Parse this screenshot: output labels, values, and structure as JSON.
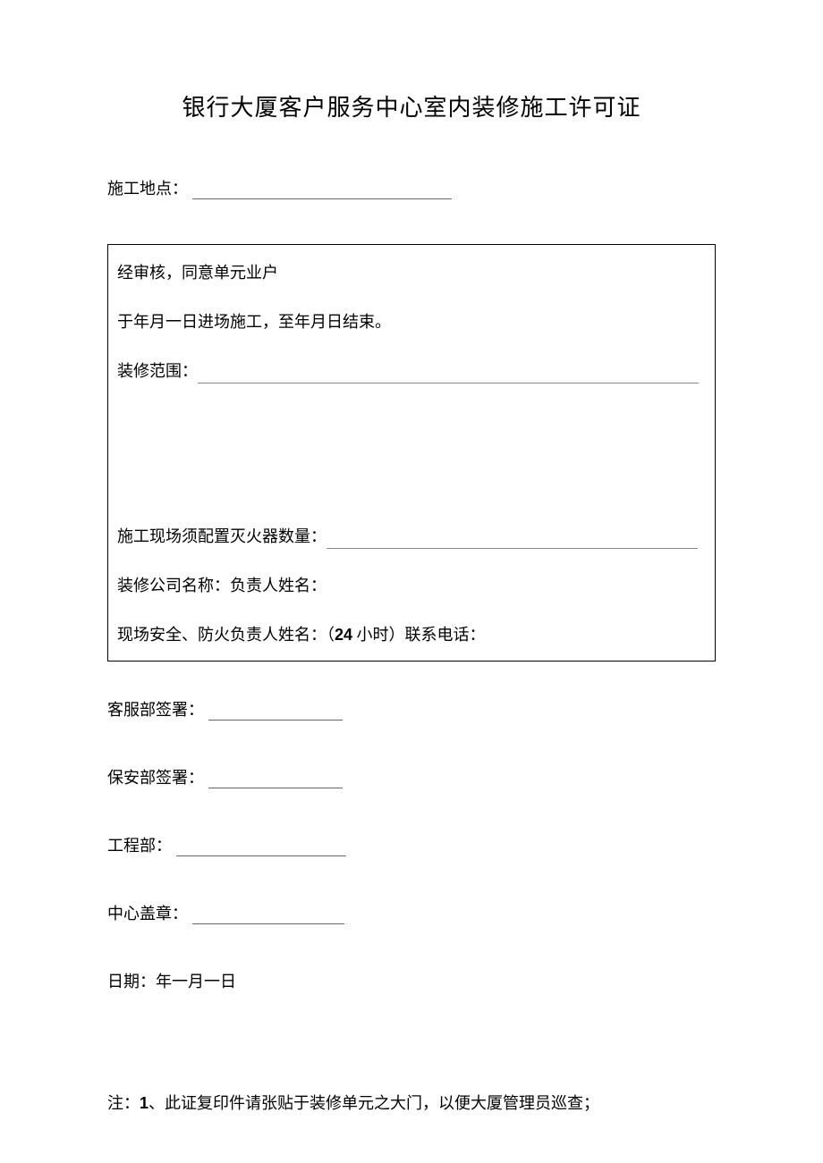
{
  "title": "银行大厦客户服务中心室内装修施工许可证",
  "location": {
    "label": "施工地点："
  },
  "box": {
    "line1": "经审核，同意单元业户",
    "line2": "于年月一日进场施工，至年月日结束。",
    "scope_label": "装修范围：",
    "extinguisher_label": "施工现场须配置灭火器数量：",
    "company_label": "装修公司名称：负责人姓名：",
    "safety_label_pre": "现场安全、防火负责人姓名：（",
    "safety_label_hours": "24",
    "safety_label_post": " 小时）联系电话："
  },
  "signatures": {
    "kefu": "客服部签署：",
    "baoan": "保安部签署：",
    "gongcheng": "工程部：",
    "zhongxin": "中心盖章：",
    "date": "日期：年一月一日"
  },
  "note": {
    "prefix": "注：",
    "num": "1",
    "text": "、此证复印件请张贴于装修单元之大门，以便大厦管理员巡查；"
  }
}
